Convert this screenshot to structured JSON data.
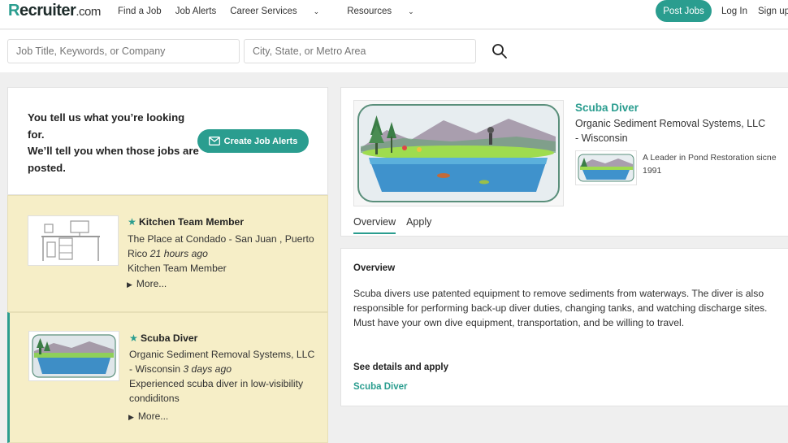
{
  "header": {
    "logo_main": "ecruiter",
    "logo_r": "R",
    "logo_suffix": ".com",
    "nav": [
      "Find a Job",
      "Job Alerts",
      "Career Services",
      "Resources"
    ],
    "post_jobs": "Post Jobs",
    "login": "Log In",
    "signup": "Sign up"
  },
  "search": {
    "keyword_placeholder": "Job Title, Keywords, or Company",
    "location_placeholder": "City, State, or Metro Area"
  },
  "alert_box": {
    "line1": "You tell us what you’re looking for.",
    "line2": "We’ll tell you when those jobs are posted.",
    "button": "Create Job Alerts"
  },
  "jobs": [
    {
      "title": "Kitchen Team Member",
      "company": "The Place at Condado - San Juan , Puerto Rico",
      "ago": "21 hours ago",
      "snippet": "Kitchen Team Member",
      "more": "More..."
    },
    {
      "title": "Scuba Diver",
      "company": "Organic Sediment Removal Systems, LLC - Wisconsin",
      "ago": "3 days ago",
      "snippet": "Experienced scuba diver in low-visibility condiditons",
      "more": "More..."
    }
  ],
  "detail": {
    "title": "Scuba Diver",
    "company": "Organic Sediment Removal Systems, LLC - Wisconsin",
    "tagline": "A Leader in Pond Restoration sicne 1991",
    "tabs": [
      "Overview",
      "Apply"
    ],
    "overview_heading": "Overview",
    "overview_text": "Scuba divers use patented equipment to remove sediments from waterways.  The diver is also responsible for performing back-up diver duties, changing tanks, and watching discharge sites. Must have your own dive equipment, transportation, and be willing to travel.",
    "see_details": "See details and apply",
    "link": "Scuba Diver"
  },
  "colors": {
    "accent": "#2a9d8f",
    "card_bg": "#f6eec7"
  }
}
